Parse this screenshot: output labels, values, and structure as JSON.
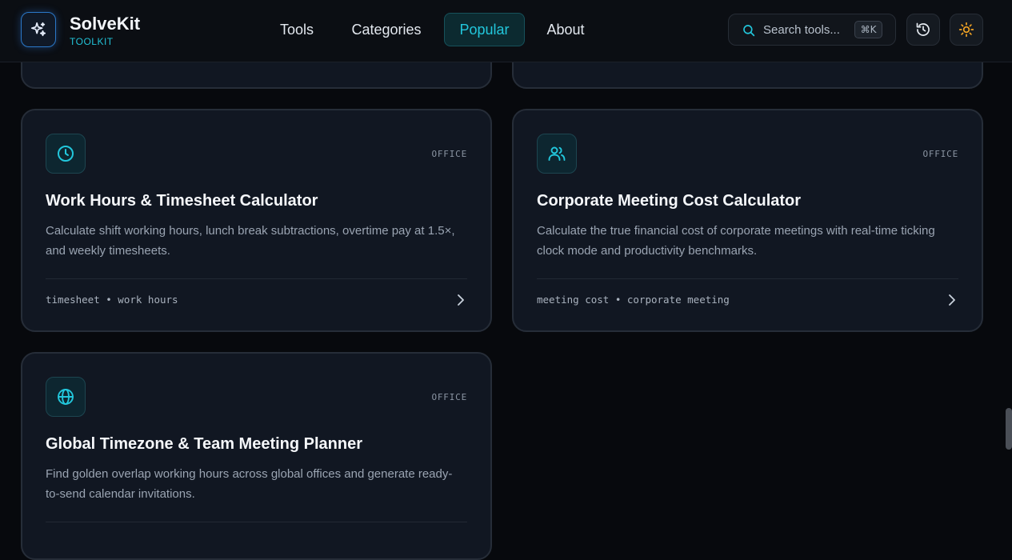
{
  "header": {
    "brand_name": "SolveKit",
    "brand_sub": "TOOLKIT",
    "nav": [
      "Tools",
      "Categories",
      "Popular",
      "About"
    ],
    "active_nav": "Popular",
    "search": {
      "placeholder": "Search tools...",
      "shortcut": "⌘K"
    }
  },
  "cards": [
    {
      "icon": "clock-icon",
      "badge": "OFFICE",
      "title": "Work Hours & Timesheet Calculator",
      "description": "Calculate shift working hours, lunch break subtractions, overtime pay at 1.5×, and weekly timesheets.",
      "tags": "timesheet • work hours"
    },
    {
      "icon": "users-icon",
      "badge": "OFFICE",
      "title": "Corporate Meeting Cost Calculator",
      "description": "Calculate the true financial cost of corporate meetings with real-time ticking clock mode and productivity benchmarks.",
      "tags": "meeting cost • corporate meeting"
    },
    {
      "icon": "globe-icon",
      "badge": "OFFICE",
      "title": "Global Timezone & Team Meeting Planner",
      "description": "Find golden overlap working hours across global offices and generate ready-to-send calendar invitations.",
      "tags": ""
    }
  ],
  "colors": {
    "accent": "#22c7dc",
    "background": "#07090d",
    "card": "#111722",
    "theme_icon": "#f5a524"
  }
}
